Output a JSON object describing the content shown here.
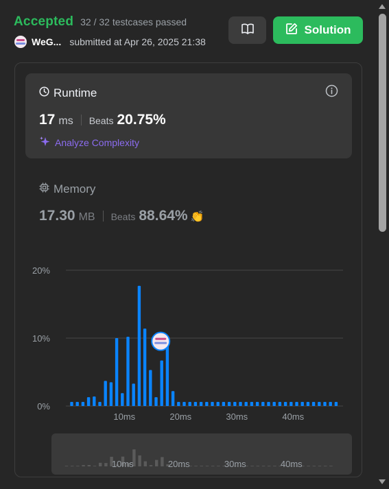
{
  "status": {
    "label": "Accepted",
    "testcases": "32 / 32 testcases passed"
  },
  "user": {
    "name": "WeG...",
    "submitted": "submitted at Apr 26, 2025 21:38"
  },
  "buttons": {
    "editorial_icon": "book-open-icon",
    "solution_label": "Solution",
    "solution_icon": "edit-icon"
  },
  "runtime": {
    "title": "Runtime",
    "value": "17",
    "unit": "ms",
    "beats_label": "Beats",
    "beats_value": "20.75%",
    "analyze_label": "Analyze Complexity"
  },
  "memory": {
    "title": "Memory",
    "value": "17.30",
    "unit": "MB",
    "beats_label": "Beats",
    "beats_value": "88.64%"
  },
  "colors": {
    "accent_green": "#2cbb5d",
    "bar_blue": "#0a84ff",
    "analyze_purple": "#8c6cf0"
  },
  "chart_data": {
    "type": "bar",
    "x": [
      1,
      2,
      3,
      4,
      5,
      6,
      7,
      8,
      9,
      10,
      11,
      12,
      13,
      14,
      15,
      16,
      17,
      18,
      19,
      20,
      21,
      22,
      23,
      24,
      25,
      26,
      27,
      28,
      29,
      30,
      31,
      32,
      33,
      34,
      35,
      36,
      37,
      38,
      39,
      40,
      41,
      42,
      43,
      44,
      45,
      46,
      47,
      48
    ],
    "values": [
      0.6,
      0.6,
      0.6,
      1.3,
      1.4,
      0.6,
      3.7,
      3.5,
      10.0,
      1.9,
      10.2,
      3.3,
      17.7,
      11.4,
      5.3,
      1.3,
      6.7,
      9.7,
      2.2,
      0.6,
      0.6,
      0.6,
      0.6,
      0.6,
      0.6,
      0.6,
      0.6,
      0.6,
      0.6,
      0.6,
      0.6,
      0.6,
      0.6,
      0.6,
      0.6,
      0.6,
      0.6,
      0.6,
      0.6,
      0.6,
      0.6,
      0.6,
      0.6,
      0.6,
      0.6,
      0.6,
      0.6,
      0.6
    ],
    "highlight_x": 17,
    "y_ticks": [
      "20%",
      "10%",
      "0%"
    ],
    "x_ticks": [
      "10ms",
      "20ms",
      "30ms",
      "40ms"
    ],
    "ylim": [
      0,
      20
    ],
    "grid": true
  },
  "navigator": {
    "x_ticks": [
      "10ms",
      "20ms",
      "30ms",
      "40ms"
    ]
  }
}
